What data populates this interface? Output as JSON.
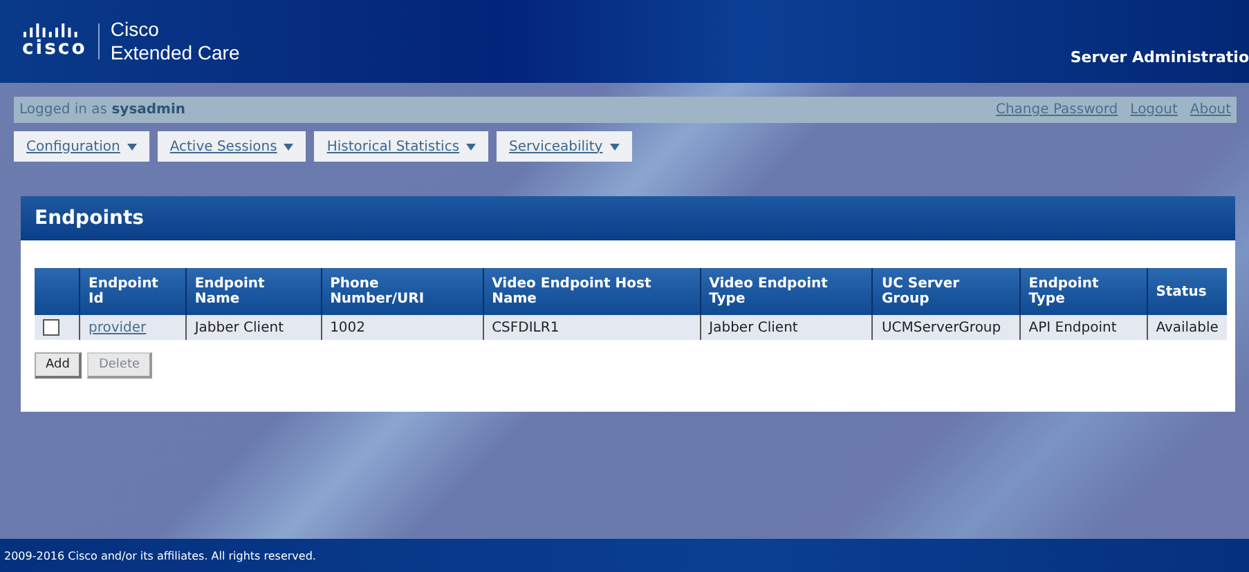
{
  "header": {
    "logo_text": "cisco",
    "product_line1": "Cisco",
    "product_line2": "Extended Care",
    "right_label": "Server Administratio"
  },
  "user_bar": {
    "prefix": "Logged in as",
    "user": "sysadmin",
    "links": [
      "Change Password",
      "Logout",
      "About"
    ]
  },
  "menus": [
    "Configuration",
    "Active Sessions",
    "Historical Statistics",
    "Serviceability"
  ],
  "panel": {
    "title": "Endpoints"
  },
  "table": {
    "columns": [
      "Endpoint Id",
      "Endpoint Name",
      "Phone Number/URI",
      "Video Endpoint Host Name",
      "Video Endpoint Type",
      "UC Server Group",
      "Endpoint Type",
      "Status"
    ],
    "rows": [
      {
        "checked": false,
        "cells": [
          "provider",
          "Jabber Client",
          "1002",
          "CSFDILR1",
          "Jabber Client",
          "UCMServerGroup",
          "API Endpoint",
          "Available"
        ]
      }
    ]
  },
  "buttons": [
    {
      "label": "Add",
      "disabled": false
    },
    {
      "label": "Delete",
      "disabled": true
    }
  ],
  "footer": "2009-2016 Cisco and/or its affiliates. All rights reserved."
}
